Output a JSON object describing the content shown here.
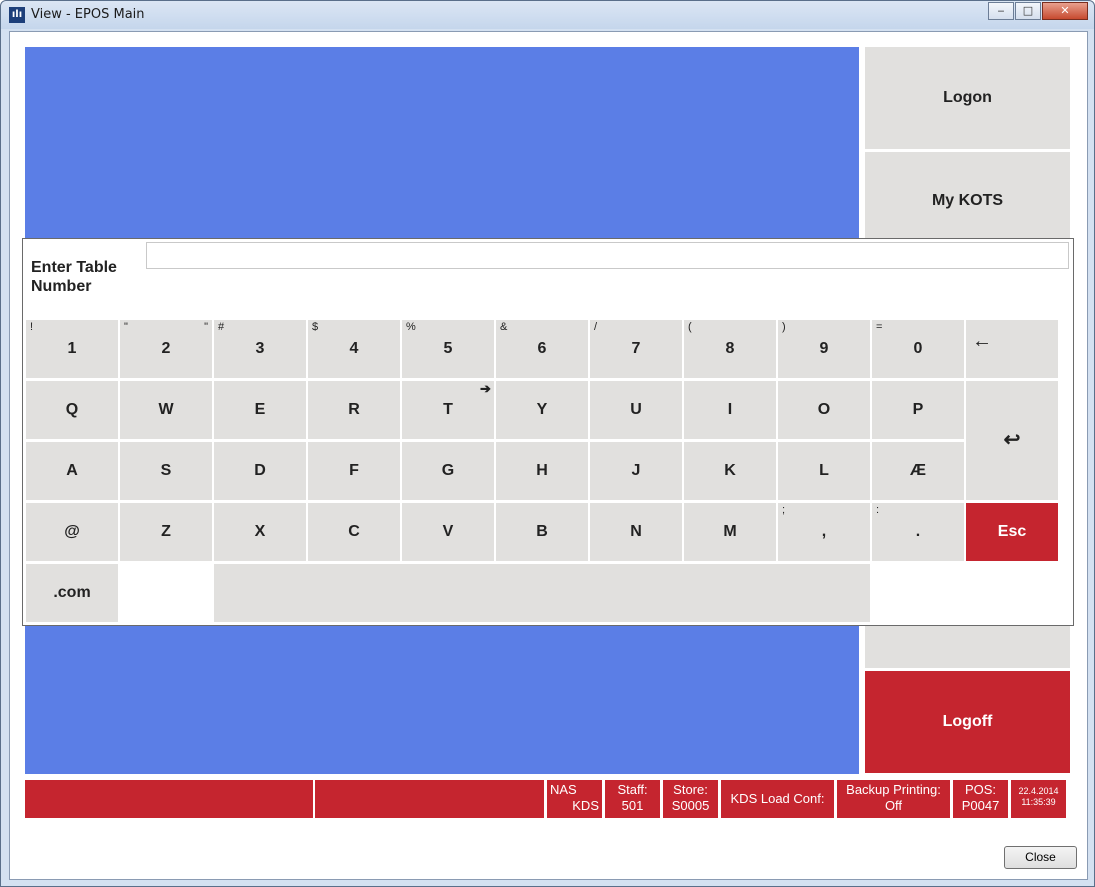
{
  "window": {
    "title": "View - EPOS Main",
    "app_icon": "bar-chart-icon",
    "min": "▭",
    "max": "□",
    "close": "✕"
  },
  "sidebar": {
    "logon": "Logon",
    "my_kots": "My KOTS",
    "logoff": "Logoff"
  },
  "status_bar": {
    "nas_l1": "NAS",
    "nas_l2": "KDS",
    "staff_l1": "Staff:",
    "staff_l2": "501",
    "store_l1": "Store:",
    "store_l2": "S0005",
    "kds": "KDS Load Conf:",
    "backup_l1": "Backup Printing:",
    "backup_l2": "Off",
    "pos_l1": "POS:",
    "pos_l2": "P0047",
    "date": "22.4.2014",
    "time": "11:35:39"
  },
  "close_button": "Close",
  "dialog": {
    "label": "Enter Table Number",
    "input_value": "",
    "row1": [
      {
        "k": "1",
        "s": "!"
      },
      {
        "k": "2",
        "s": "\"",
        "s2": "\""
      },
      {
        "k": "3",
        "s": "#"
      },
      {
        "k": "4",
        "s": "$"
      },
      {
        "k": "5",
        "s": "%"
      },
      {
        "k": "6",
        "s": "&"
      },
      {
        "k": "7",
        "s": "/"
      },
      {
        "k": "8",
        "s": "("
      },
      {
        "k": "9",
        "s": ")"
      },
      {
        "k": "0",
        "s": "="
      }
    ],
    "backspace": "←",
    "row2": [
      "Q",
      "W",
      "E",
      "R",
      "T",
      "Y",
      "U",
      "I",
      "O",
      "P"
    ],
    "tab_arrow": "➔",
    "enter": "↩",
    "row3": [
      "A",
      "S",
      "D",
      "F",
      "G",
      "H",
      "J",
      "K",
      "L",
      "Æ"
    ],
    "row4": [
      {
        "k": "@"
      },
      {
        "k": "Z"
      },
      {
        "k": "X"
      },
      {
        "k": "C"
      },
      {
        "k": "V"
      },
      {
        "k": "B"
      },
      {
        "k": "N"
      },
      {
        "k": "M"
      },
      {
        "k": ",",
        "s": ";"
      },
      {
        "k": ".",
        "s": ":"
      }
    ],
    "esc": "Esc",
    "dotcom": ".com",
    "space": ""
  }
}
